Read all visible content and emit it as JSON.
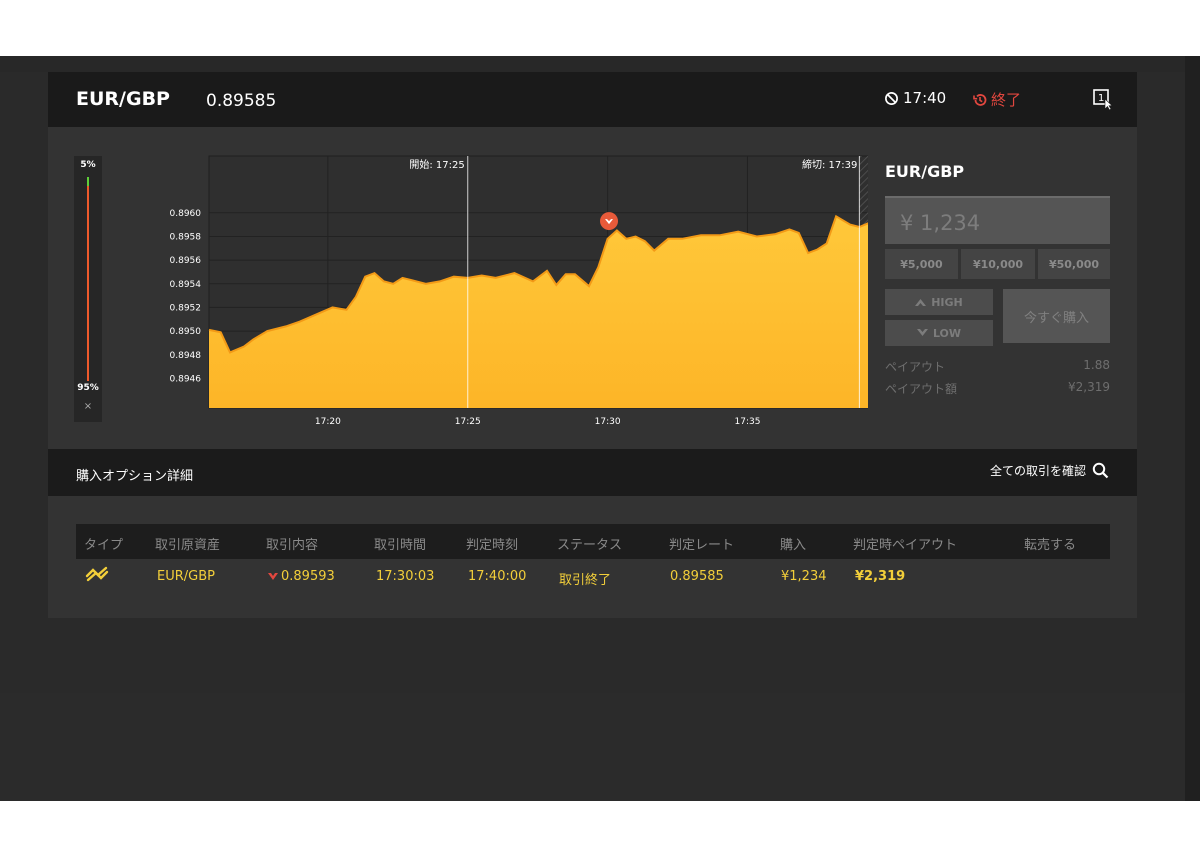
{
  "header": {
    "pair": "EUR/GBP",
    "price": "0.89585",
    "timer": "17:40",
    "status": "終了"
  },
  "ratio": {
    "high_pct": "5%",
    "low_pct": "95%",
    "close": "×"
  },
  "chart_data": {
    "type": "area",
    "y_ticks": [
      "0.8960",
      "0.8958",
      "0.8956",
      "0.8954",
      "0.8952",
      "0.8950",
      "0.8948",
      "0.8946"
    ],
    "x_ticks": [
      "17:20",
      "17:25",
      "17:30",
      "17:35"
    ],
    "start_label": "開始: 17:25",
    "end_label": "締切: 17:39",
    "ylim": [
      0.89435,
      0.89648
    ],
    "xlim_minutes": [
      "17:15:45",
      "17:40:40"
    ],
    "entry": {
      "time": "17:30:03",
      "value": 0.89593,
      "direction": "low"
    },
    "series": [
      {
        "x": [
          "17:15:45",
          "17:16:10",
          "17:16:30",
          "17:17:00",
          "17:17:20",
          "17:17:50",
          "17:18:30",
          "17:19:00",
          "17:19:40",
          "17:20:10",
          "17:20:40",
          "17:21:00",
          "17:21:20",
          "17:21:40",
          "17:22:00",
          "17:22:20",
          "17:22:40",
          "17:23:00",
          "17:23:30",
          "17:24:00",
          "17:24:30",
          "17:25:00",
          "17:25:30",
          "17:26:00",
          "17:26:40",
          "17:27:20",
          "17:27:50",
          "17:28:10",
          "17:28:30",
          "17:28:50",
          "17:29:20",
          "17:29:40",
          "17:30:00",
          "17:30:20",
          "17:30:40",
          "17:31:00",
          "17:31:20",
          "17:31:40",
          "17:32:10",
          "17:32:40",
          "17:33:20",
          "17:34:00",
          "17:34:40",
          "17:35:20",
          "17:36:00",
          "17:36:30",
          "17:36:50",
          "17:37:10",
          "17:37:30",
          "17:37:50",
          "17:38:10",
          "17:38:40",
          "17:39:00",
          "17:39:30",
          "17:39:50",
          "17:40:20",
          "17:40:40"
        ],
        "y": [
          0.89501,
          0.89499,
          0.89482,
          0.89487,
          0.89493,
          0.895,
          0.89504,
          0.89508,
          0.89515,
          0.8952,
          0.89518,
          0.89529,
          0.89546,
          0.89549,
          0.89542,
          0.8954,
          0.89545,
          0.89543,
          0.8954,
          0.89542,
          0.89546,
          0.89545,
          0.89547,
          0.89545,
          0.89549,
          0.89542,
          0.89551,
          0.89539,
          0.89548,
          0.89548,
          0.89538,
          0.89554,
          0.89578,
          0.89585,
          0.89578,
          0.8958,
          0.89576,
          0.89568,
          0.89578,
          0.89578,
          0.89581,
          0.89581,
          0.89584,
          0.8958,
          0.89582,
          0.89586,
          0.89583,
          0.89566,
          0.89569,
          0.89574,
          0.89597,
          0.8959,
          0.89588,
          0.89593,
          0.89582,
          0.89586,
          0.89585
        ]
      }
    ]
  },
  "order": {
    "pair": "EUR/GBP",
    "amount_placeholder": "¥ 1,234",
    "quick_amounts": [
      "¥5,000",
      "¥10,000",
      "¥50,000"
    ],
    "high_label": "HIGH",
    "low_label": "LOW",
    "buy_now_label": "今すぐ購入",
    "payout_label": "ペイアウト",
    "payout_value": "1.88",
    "payout_amount_label": "ペイアウト額",
    "payout_amount_value": "¥2,319"
  },
  "details": {
    "title": "購入オプション詳細",
    "view_all": "全ての取引を確認",
    "columns": [
      "タイプ",
      "取引原資産",
      "取引内容",
      "取引時間",
      "判定時刻",
      "ステータス",
      "判定レート",
      "購入",
      "判定時ペイアウト",
      "転売する"
    ],
    "row": {
      "asset": "EUR/GBP",
      "content": "0.89593",
      "trade_time": "17:30:03",
      "judge_time": "17:40:00",
      "status": "取引終了",
      "judge_rate": "0.89585",
      "purchase": "¥1,234",
      "payout": "¥2,319"
    }
  },
  "colors": {
    "area_fill": "#fdbf2c",
    "area_line": "#f39a16",
    "accent_red": "#e2473f",
    "table_yellow": "#f3cf3a"
  }
}
